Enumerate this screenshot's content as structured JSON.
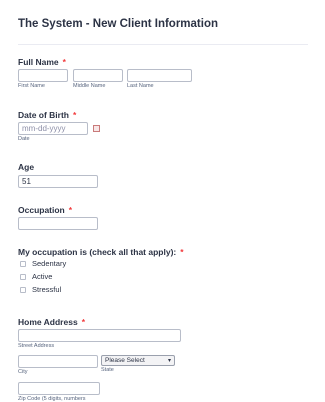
{
  "form": {
    "title": "The System - New Client Information",
    "required_mark": "*",
    "full_name": {
      "label": "Full Name",
      "first_sublabel": "First Name",
      "middle_sublabel": "Middle Name",
      "last_sublabel": "Last Name",
      "first_value": "",
      "middle_value": "",
      "last_value": ""
    },
    "dob": {
      "label": "Date of Birth",
      "placeholder": "mm-dd-yyyy",
      "sublabel": "Date",
      "calendar_icon": "calendar-icon"
    },
    "age": {
      "label": "Age",
      "value": "51"
    },
    "occupation": {
      "label": "Occupation",
      "value": ""
    },
    "occupation_type": {
      "label": "My occupation is (check all that apply):",
      "options": [
        "Sedentary",
        "Active",
        "Stressful"
      ]
    },
    "address": {
      "label": "Home Address",
      "street_sublabel": "Street Address",
      "city_sublabel": "City",
      "state_sublabel": "State",
      "state_selected": "Please Select",
      "zip_sublabel": "Zip Code (5 digits, numbers"
    }
  },
  "colors": {
    "required": "#f23a3c",
    "text": "#2c3345",
    "border": "#b8bdc9"
  }
}
